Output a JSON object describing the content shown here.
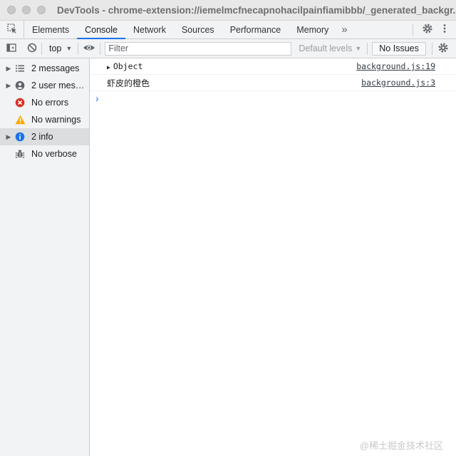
{
  "window": {
    "title": "DevTools - chrome-extension://iemelmcfnecapnohacilpainfiamibbb/_generated_backgr..."
  },
  "tabs": {
    "items": [
      "Elements",
      "Console",
      "Network",
      "Sources",
      "Performance",
      "Memory"
    ],
    "active": "Console",
    "more_glyph": "»"
  },
  "toolbar": {
    "context": "top",
    "filter_placeholder": "Filter",
    "filter_value": "",
    "levels": "Default levels",
    "issues": "No Issues"
  },
  "sidebar": {
    "items": [
      {
        "label": "2 messages",
        "icon": "list-icon",
        "expandable": true
      },
      {
        "label": "2 user mes…",
        "icon": "user-icon",
        "expandable": true
      },
      {
        "label": "No errors",
        "icon": "error-icon",
        "expandable": false
      },
      {
        "label": "No warnings",
        "icon": "warning-icon",
        "expandable": false
      },
      {
        "label": "2 info",
        "icon": "info-icon",
        "expandable": true,
        "selected": true
      },
      {
        "label": "No verbose",
        "icon": "bug-icon",
        "expandable": false
      }
    ]
  },
  "console": {
    "messages": [
      {
        "text": "Object",
        "source": "background.js:19",
        "expandable": true
      },
      {
        "text": "虾皮的橙色",
        "source": "background.js:3",
        "expandable": false
      }
    ],
    "prompt": "›"
  },
  "watermark": "@稀土掘金技术社区",
  "colors": {
    "accent": "#1a73e8",
    "error": "#d93025",
    "warning": "#f9ab00",
    "info": "#1a73e8"
  }
}
